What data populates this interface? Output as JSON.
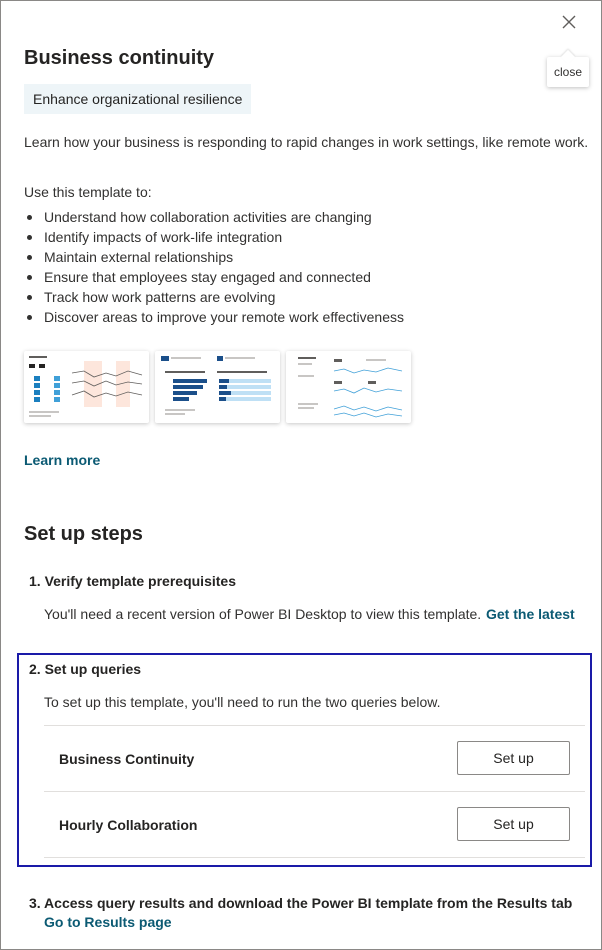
{
  "panel": {
    "close_tooltip": "close",
    "title": "Business continuity",
    "tag": "Enhance organizational resilience",
    "description": "Learn how your business is responding to rapid changes in work settings, like remote work.",
    "use_intro": "Use this template to:",
    "bullets": [
      "Understand how collaboration activities are changing",
      "Identify impacts of work-life integration",
      "Maintain external relationships",
      "Ensure that employees stay engaged and connected",
      "Track how work patterns are evolving",
      "Discover areas to improve your remote work effectiveness"
    ],
    "learn_more": "Learn more"
  },
  "setup": {
    "title": "Set up steps",
    "step1": {
      "title": "1. Verify template prerequisites",
      "text": "You'll need a recent version of Power BI Desktop to view this template.",
      "link": "Get the latest"
    },
    "step2": {
      "title": "2. Set up queries",
      "text": "To set up this template, you'll need to run the two queries below.",
      "queries": [
        {
          "name": "Business Continuity",
          "button": "Set up"
        },
        {
          "name": "Hourly Collaboration",
          "button": "Set up"
        }
      ]
    },
    "step3": {
      "title": "3. Access query results and download the Power BI template from the Results tab",
      "link": "Go to Results page"
    }
  },
  "colors": {
    "accent_link": "#0b5a73",
    "tag_background": "#eef5f8",
    "focus_border": "#1a1aa8",
    "thumb_bar": "#1b7fbf"
  },
  "icons": {
    "close": "close-icon"
  }
}
